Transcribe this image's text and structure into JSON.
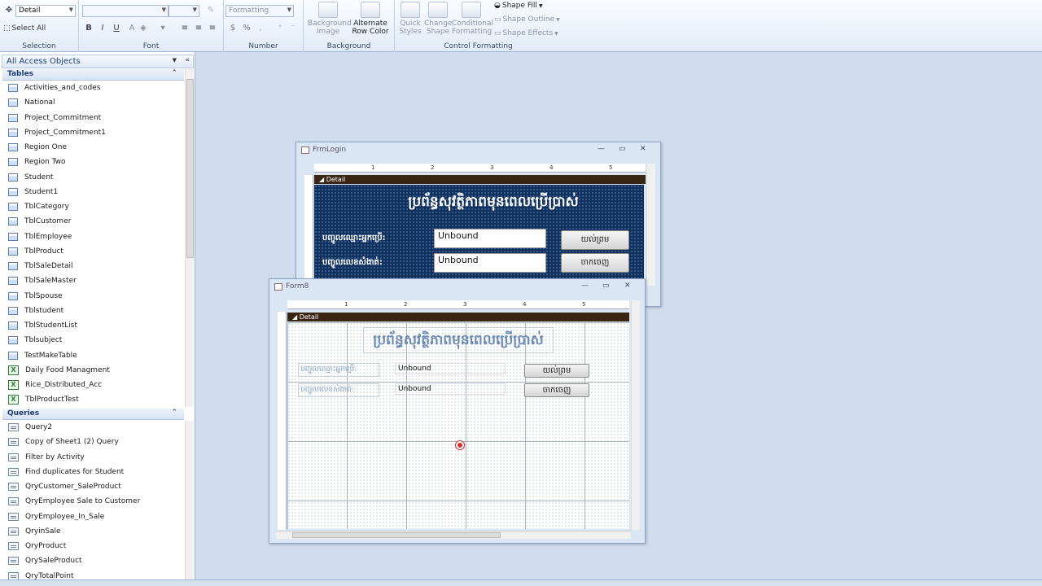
{
  "ribbon": {
    "object_select": "Detail",
    "select_all": "Select All",
    "selection_label": "Selection",
    "font_label": "Font",
    "number_format": "Formatting",
    "number_label": "Number",
    "background_image": "Background Image",
    "alternate_row_color": "Alternate Row Color",
    "background_label": "Background",
    "quick_styles": "Quick Styles",
    "change_shape": "Change Shape",
    "conditional_formatting": "Conditional Formatting",
    "shape_fill": "Shape Fill",
    "shape_outline": "Shape Outline",
    "shape_effects": "Shape Effects",
    "control_formatting_label": "Control Formatting"
  },
  "nav": {
    "header": "All Access Objects",
    "tables_header": "Tables",
    "tables": [
      "Activities_and_codes",
      "National",
      "Project_Commitment",
      "Project_Commitment1",
      "Region One",
      "Region Two",
      "Student",
      "Student1",
      "TblCategory",
      "TblCustomer",
      "TblEmployee",
      "TblProduct",
      "TblSaleDetail",
      "TblSaleMaster",
      "TblSpouse",
      "Tblstudent",
      "TblStudentList",
      "Tblsubject",
      "TestMakeTable"
    ],
    "linked": [
      "Daily Food Managment",
      "Rice_Distributed_Acc",
      "TblProductTest"
    ],
    "queries_header": "Queries",
    "queries": [
      "Query2",
      "Copy of Sheet1 (2) Query",
      "Filter by Activity",
      "Find duplicates for Student",
      "QryCustomer_SaleProduct",
      "QryEmployee Sale to Customer",
      "QryEmployee_In_Sale",
      "QryinSale",
      "QryProduct",
      "QrySaleProduct",
      "QryTotalPoint"
    ]
  },
  "frmlogin": {
    "title": "FrmLogin",
    "section": "Detail",
    "heading": "ប្រព័ន្ធសុវត្ថិភាពមុនពេលប្រើប្រាស់",
    "label_user": "បញ្ចូលឈ្មោះអ្នកប្រើ:",
    "label_pass": "បញ្ចូលលេខសំងាត់:",
    "field_user": "Unbound",
    "field_pass": "Unbound",
    "btn_ok": "យល់ព្រម",
    "btn_exit": "ចាកចេញ"
  },
  "form8": {
    "title": "Form8",
    "section": "Detail",
    "heading": "ប្រព័ន្ធសុវត្ថិភាពមុនពេលប្រើប្រាស់",
    "label_user": "បញ្ចូលឈ្មោះអ្នកប្រើ:",
    "label_pass": "បញ្ចូលលេខសំងាត់:",
    "field_user": "Unbound",
    "field_pass": "Unbound",
    "btn_ok": "យល់ព្រម",
    "btn_exit": "ចាកចេញ"
  },
  "ruler_ticks": [
    "1",
    "2",
    "3",
    "4",
    "5"
  ],
  "colors": {
    "accent": "#1e3f7a",
    "form_blue": "#10305e",
    "detail_bar": "#3a2412"
  }
}
